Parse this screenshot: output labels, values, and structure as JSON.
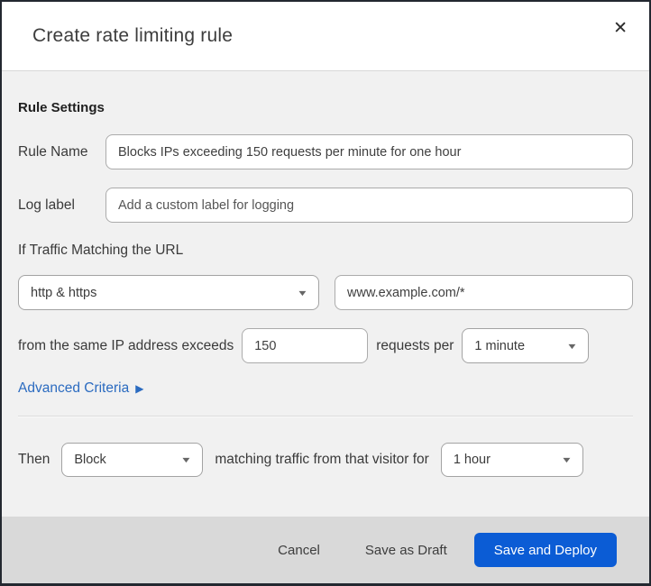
{
  "modal": {
    "title": "Create rate limiting rule"
  },
  "icons": {
    "close": "✕",
    "caret_down": "▼",
    "caret_right": "▶"
  },
  "rule_settings": {
    "heading": "Rule Settings",
    "rule_name": {
      "label": "Rule Name",
      "value": "Blocks IPs exceeding 150 requests per minute for one hour"
    },
    "log_label": {
      "label": "Log label",
      "placeholder": "Add a custom label for logging"
    }
  },
  "traffic_match": {
    "heading": "If Traffic Matching the URL",
    "scheme_select": {
      "value": "http & https"
    },
    "url_input": {
      "value": "www.example.com/*"
    },
    "threshold": {
      "prefix": "from the same IP address exceeds",
      "requests_value": "150",
      "middle": "requests per",
      "period_select": {
        "value": "1 minute"
      }
    },
    "advanced_criteria": {
      "label": "Advanced Criteria"
    }
  },
  "action": {
    "then_label": "Then",
    "action_select": {
      "value": "Block"
    },
    "middle": "matching traffic from that visitor for",
    "duration_select": {
      "value": "1 hour"
    }
  },
  "footer": {
    "cancel": "Cancel",
    "save_draft": "Save as Draft",
    "save_deploy": "Save and Deploy"
  },
  "colors": {
    "primary_button": "#0b5cd5",
    "link_blue": "#2b6bc0",
    "footer_bg": "#d9d9d9",
    "body_bg": "#f1f1f1"
  }
}
